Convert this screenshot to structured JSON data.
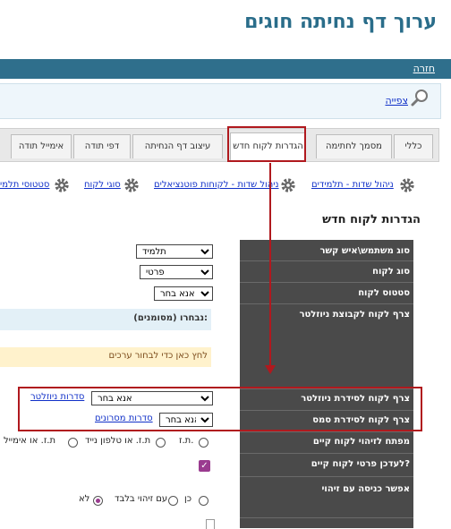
{
  "page": {
    "title": "ערוך דף נחיתה חוגים"
  },
  "nav": {
    "back_label": "חזרה",
    "view_label": "צפייה"
  },
  "tabs": [
    {
      "label": "כללי"
    },
    {
      "label": "מסמך לחתימה"
    },
    {
      "label": "הגדרות לקוח חדש",
      "active": true
    },
    {
      "label": "עיצוב דף הנחיתה"
    },
    {
      "label": "דפי תודה"
    },
    {
      "label": "אימייל תודה"
    }
  ],
  "links": [
    {
      "label": "ניהול שדות - תלמידים"
    },
    {
      "label": "ניהול שדות - לקוחות פוטנציאלים"
    },
    {
      "label": "סוגי לקוח"
    },
    {
      "label": "סטטוסי תלמי"
    }
  ],
  "section_title": "הגדרות לקוח חדש",
  "form": {
    "contact_type": {
      "label": "סוג משתמש\\איש קשר",
      "value": "תלמיד"
    },
    "client_type": {
      "label": "סוג לקוח",
      "value": "פרטי"
    },
    "client_status": {
      "label": "סטטוס לקוח",
      "value": "אנא בחר"
    },
    "newsletter_group": {
      "label": "צרף לקוח לקבוצת ניוזלטר",
      "selected_text": "נבחרו (מסומנים):",
      "click_hint": "לחץ כאן כדי לבחור ערכים"
    },
    "newsletter_series": {
      "label": "צרף לקוח לסידרת ניוזלטר",
      "value": "אנא בחר",
      "link": "סדרות ניוזלטר"
    },
    "sms_series": {
      "label": "צרף לקוח לסידרת סמס",
      "value": "אנא בחר",
      "link": "סדרות מסרונים"
    },
    "identify_key": {
      "label": "מפתח לזיהוי לקוח קיים",
      "options": [
        "ת.ז.",
        "ת.ז. או טלפון נייד",
        "ת.ז. או אימייל"
      ]
    },
    "update_existing": {
      "label": "לעדכן פרטי לקוח קיים?"
    },
    "allow_login": {
      "label": "אפשר כניסה עם זיהוי",
      "options": [
        "כן",
        "עם זיהוי בלבד",
        "לא"
      ]
    }
  }
}
